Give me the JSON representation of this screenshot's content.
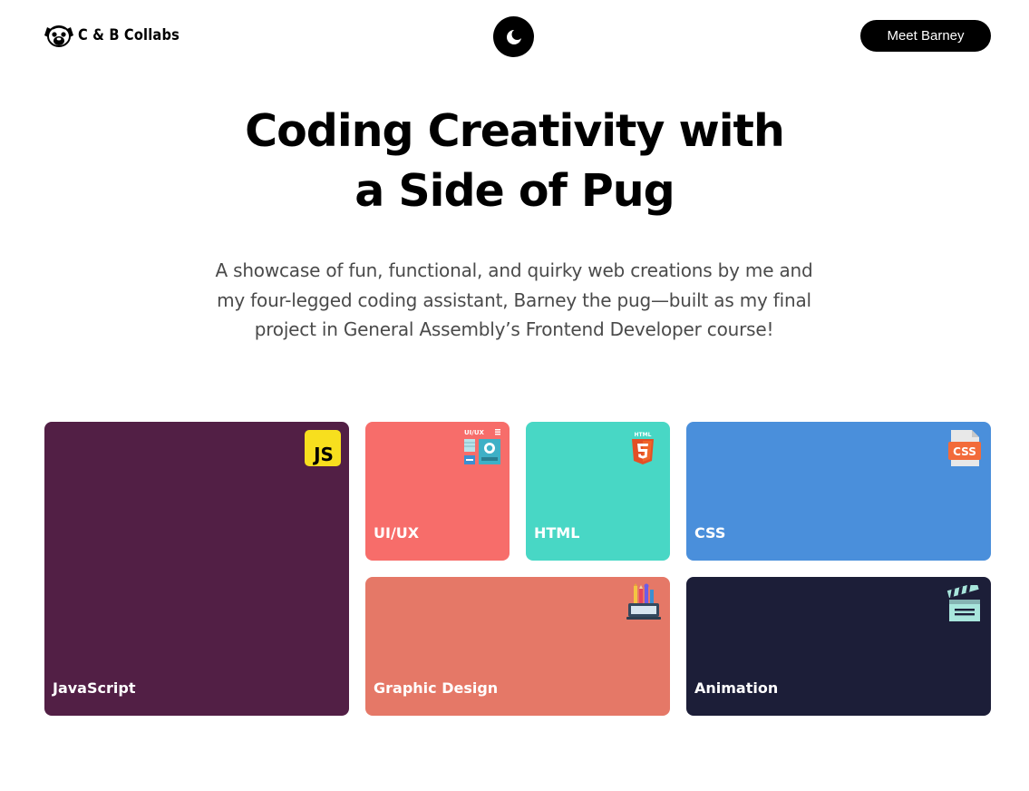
{
  "header": {
    "logo_text": "C & B Collabs",
    "logo_icon": "pug-face-icon",
    "theme_toggle_icon": "moon-icon",
    "cta_label": "Meet Barney"
  },
  "hero": {
    "title_line1": "Coding Creativity with",
    "title_line2": "a Side of Pug",
    "subtitle": "A showcase of fun, functional, and quirky web creations by me and my four-legged coding assistant, Barney the pug—built as my final project in General Assembly’s Frontend Developer course!"
  },
  "tiles": [
    {
      "label": "JavaScript",
      "icon": "javascript-icon",
      "icon_text": "JS",
      "color": "#521f45"
    },
    {
      "label": "UI/UX",
      "icon": "ui-ux-icon",
      "icon_text": "UI/UX",
      "color": "#f76d6a"
    },
    {
      "label": "HTML",
      "icon": "html5-icon",
      "icon_text": "HTML",
      "color": "#48d7c5"
    },
    {
      "label": "CSS",
      "icon": "css-file-icon",
      "icon_text": "CSS",
      "color": "#4a8fdb"
    },
    {
      "label": "Graphic Design",
      "icon": "design-tools-icon",
      "color": "#e57867"
    },
    {
      "label": "Animation",
      "icon": "clapperboard-icon",
      "color": "#1c1e38"
    }
  ]
}
